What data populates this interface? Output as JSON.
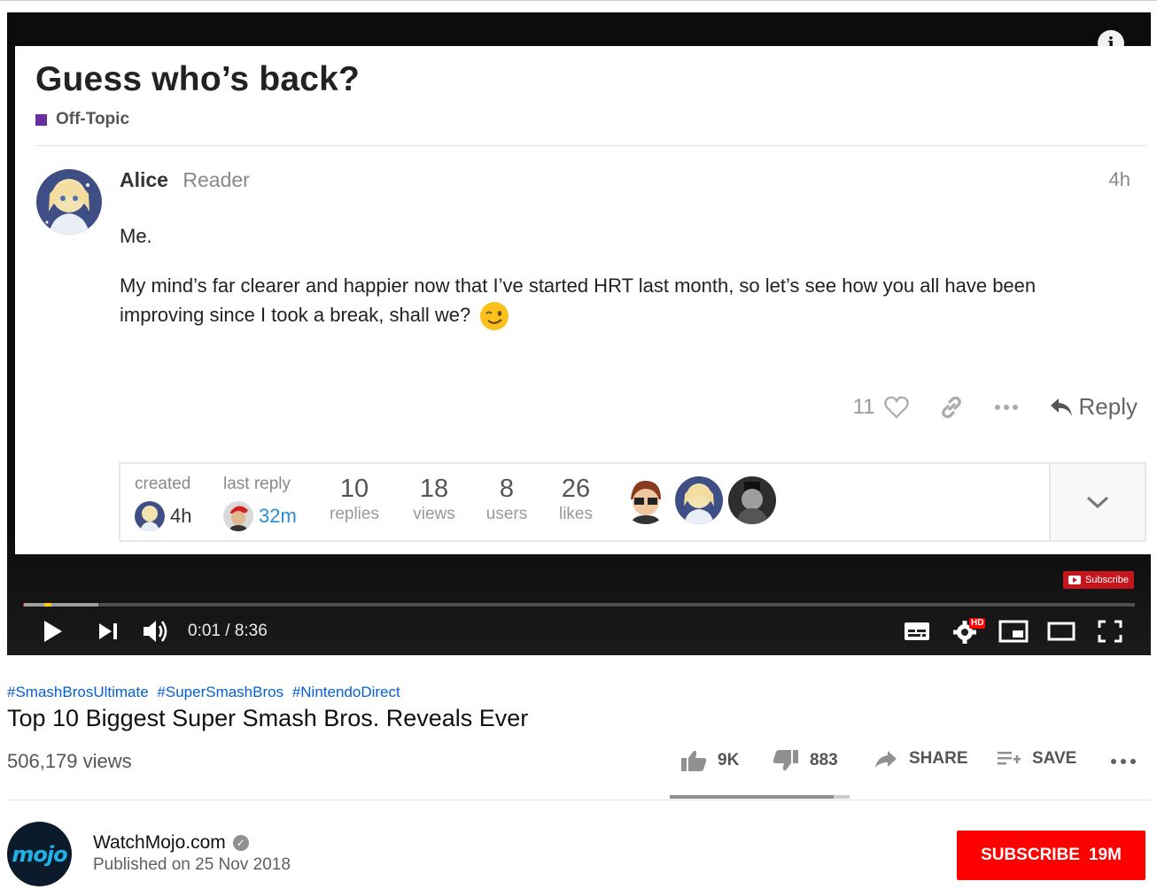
{
  "forum": {
    "title": "Guess who’s back?",
    "category": "Off-Topic",
    "category_color": "#6a2fa0",
    "post": {
      "username": "Alice",
      "role": "Reader",
      "age": "4h",
      "paragraph1": "Me.",
      "paragraph2": "My mind’s far clearer and happier now that I’ve started HRT last month, so let’s see how you all have been improving since I took a break, shall we?",
      "emoji": "winking-face-icon",
      "likes": "11",
      "reply_label": "Reply"
    },
    "topic_map": {
      "created_label": "created",
      "created_value": "4h",
      "last_reply_label": "last reply",
      "last_reply_value": "32m",
      "replies_num": "10",
      "replies_label": "replies",
      "views_num": "18",
      "views_label": "views",
      "users_num": "8",
      "users_label": "users",
      "likes_num": "26",
      "likes_label": "likes"
    }
  },
  "player": {
    "time": "0:01 / 8:36",
    "subscribe_badge": "Subscribe",
    "hd_badge": "HD",
    "played_fraction": 0.001,
    "buffered_fraction": 0.068
  },
  "video": {
    "hashtags": [
      "#SmashBrosUltimate",
      "#SuperSmashBros",
      "#NintendoDirect"
    ],
    "title": "Top 10 Biggest Super Smash Bros. Reveals Ever",
    "views": "506,179 views",
    "likes": "9K",
    "dislikes": "883",
    "share_label": "SHARE",
    "save_label": "SAVE",
    "like_ratio": 0.91
  },
  "channel": {
    "name": "WatchMojo.com",
    "logo_text": "mojo",
    "published": "Published on 25 Nov 2018",
    "subscribe_label": "SUBSCRIBE",
    "subscriber_count": "19M"
  },
  "colors": {
    "accent_red": "#ff0000",
    "link_blue": "#065fd4",
    "time_blue": "#2b8bd6"
  }
}
